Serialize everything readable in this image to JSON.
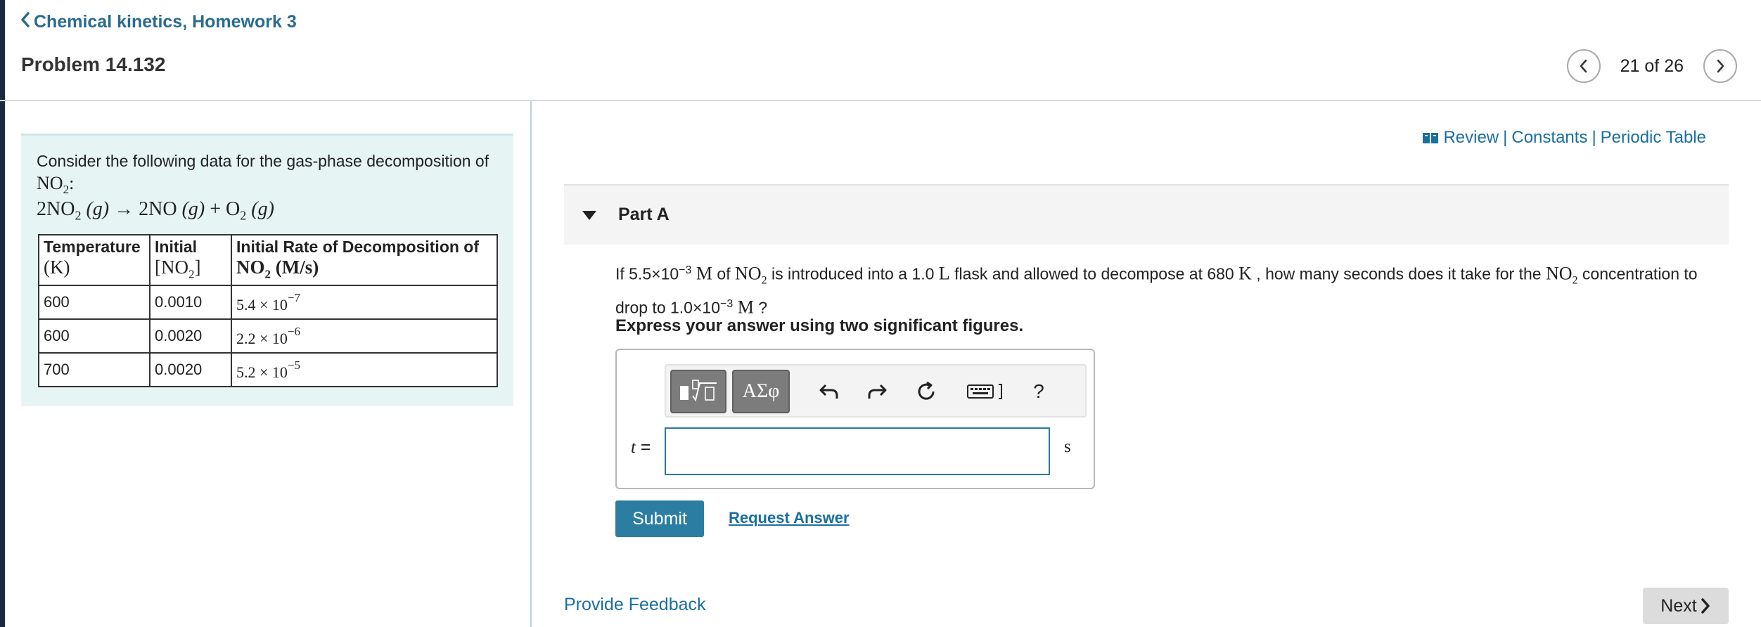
{
  "header": {
    "breadcrumb": "Chemical kinetics, Homework 3",
    "problem_title": "Problem 14.132",
    "pager": {
      "position": "21 of 26"
    }
  },
  "info": {
    "intro": "Consider the following data for the gas-phase decomposition of",
    "formula": "NO",
    "formula_sub": "2",
    "formula_suffix": ":",
    "equation": {
      "lhs_coef": "2NO",
      "lhs_sub": "2",
      "lhs_state": "(g)",
      "arrow": "→",
      "p1": "2NO",
      "p1_state": "(g)",
      "plus": "+",
      "p2": "O",
      "p2_sub": "2",
      "p2_state": "(g)"
    },
    "table": {
      "headers": [
        {
          "label": "Temperature",
          "unit": "(K)"
        },
        {
          "label": "Initial",
          "unit_pre": "[NO",
          "unit_sub": "2",
          "unit_post": "]"
        },
        {
          "label": "Initial Rate of Decomposition of",
          "unit_pre": "NO",
          "unit_sub": "2",
          "unit_post": " (M/s)"
        }
      ],
      "rows": [
        {
          "temp": "600",
          "conc": "0.0010",
          "rate_mant": "5.4",
          "times": "×",
          "rate_base": "10",
          "rate_exp": "−7"
        },
        {
          "temp": "600",
          "conc": "0.0020",
          "rate_mant": "2.2",
          "times": "×",
          "rate_base": "10",
          "rate_exp": "−6"
        },
        {
          "temp": "700",
          "conc": "0.0020",
          "rate_mant": "5.2",
          "times": "×",
          "rate_base": "10",
          "rate_exp": "−5"
        }
      ]
    }
  },
  "resources": {
    "review": "Review",
    "sep": "|",
    "constants": "Constants",
    "periodic": "Periodic Table"
  },
  "part": {
    "label": "Part A",
    "question": {
      "t1": "If 5.5×10",
      "t1_exp": "−3",
      "m1": " M",
      "t2": " of ",
      "no2": "NO",
      "no2_sub": "2",
      "t3": " is introduced into a 1.0 ",
      "L": "L",
      "t4": " flask and allowed to decompose at 680 ",
      "K": "K",
      "t5": " , how many seconds does it take for the ",
      "t6": " concentration to drop to 1.0×10",
      "t6_exp": "−3",
      "m2": " M",
      "t7": " ?"
    },
    "instruction": "Express your answer using two significant figures.",
    "answer": {
      "variable": "t",
      "equals": " =",
      "value": "",
      "unit": "s"
    },
    "toolbar": {
      "greek_label": "ΑΣφ",
      "help_label": "?"
    },
    "submit_label": "Submit",
    "request_label": "Request Answer"
  },
  "footer": {
    "feedback_label": "Provide Feedback",
    "next_label": "Next"
  }
}
